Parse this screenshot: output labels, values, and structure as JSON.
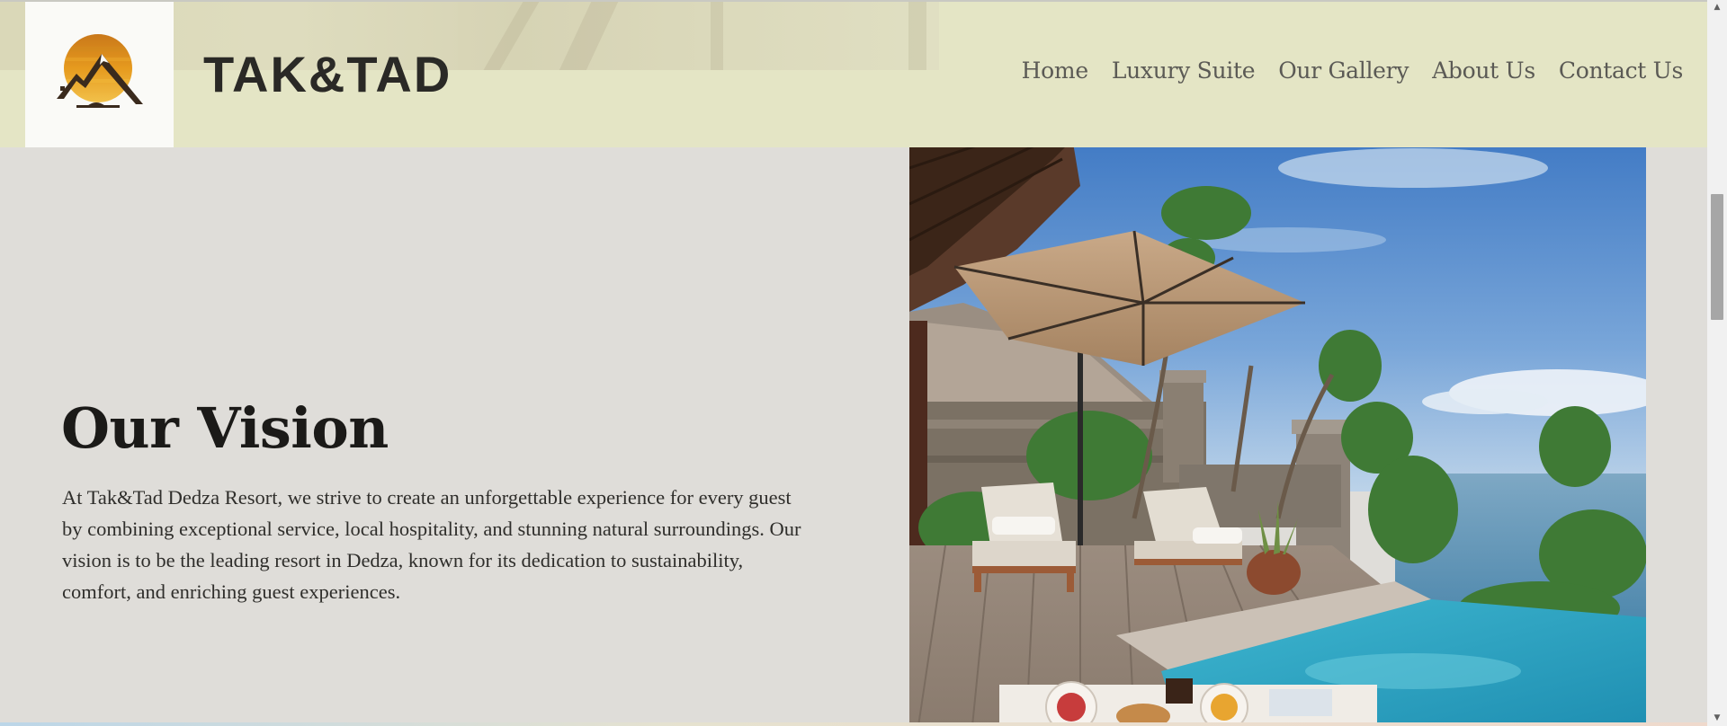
{
  "header": {
    "brand": "TAK&TAD",
    "nav": [
      {
        "label": "Home"
      },
      {
        "label": "Luxury Suite"
      },
      {
        "label": "Our Gallery"
      },
      {
        "label": "About Us"
      },
      {
        "label": "Contact Us"
      }
    ]
  },
  "vision": {
    "title": "Our Vision",
    "body": "At Tak&Tad Dedza Resort, we strive to create an unforgettable experience for every guest by combining exceptional service, local hospitality, and stunning natural surroundings. Our vision is to be the leading resort in Dedza, known for its dedication to sustainability, comfort, and enriching guest experiences."
  },
  "colors": {
    "header_bg": "#e4e5c5",
    "page_bg": "#dfddd9",
    "logo_orange": "#e0901c",
    "logo_dark": "#3a2a1d"
  },
  "icons": {
    "logo": "mountain-sun-logo-icon",
    "scroll_up": "triangle-up-icon",
    "scroll_down": "triangle-down-icon"
  }
}
